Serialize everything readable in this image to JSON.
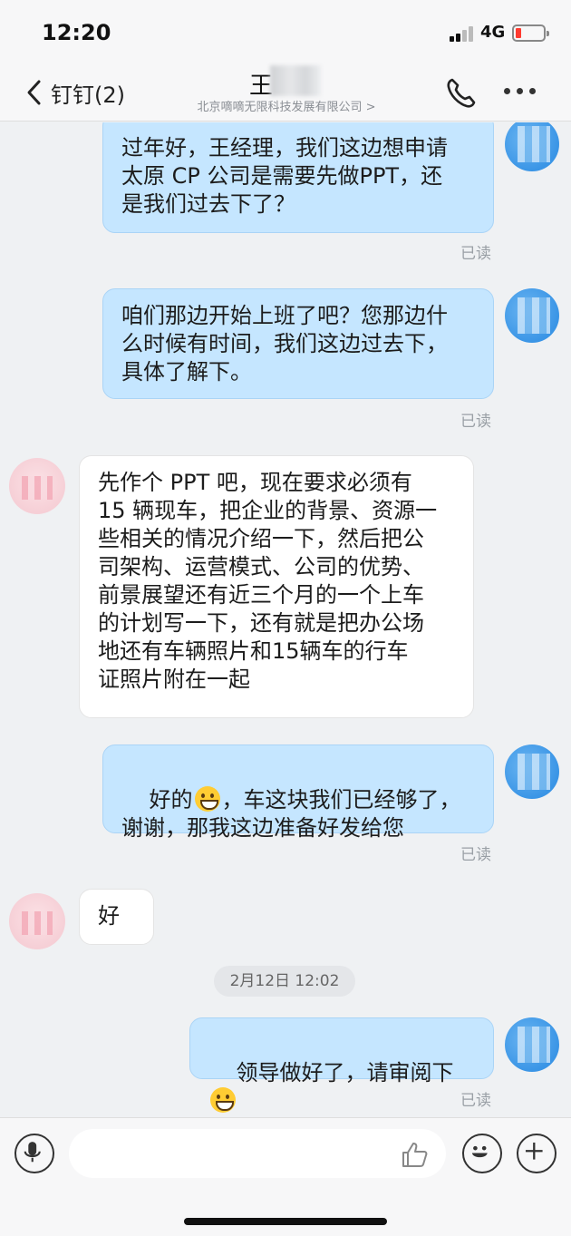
{
  "status_bar": {
    "time": "12:20",
    "network": "4G",
    "battery_level": 0.15,
    "battery_color": "#ff3b30"
  },
  "nav": {
    "back_label": "钉钉(2)",
    "back_icon": "chevron-left-icon",
    "title_visible_char": "王",
    "subtitle": "北京嘀嘀无限科技发展有限公司 >",
    "call_icon": "phone-icon",
    "more_icon": "more-dots-icon"
  },
  "messages": [
    {
      "direction": "out",
      "text": "过年好，王经理，我们这边想申请\n太原 CP 公司是需要先做PPT，还\n是我们过去下了？",
      "read": "已读"
    },
    {
      "direction": "out",
      "text": "咱们那边开始上班了吧？您那边什\n么时候有时间，我们这边过去下，\n具体了解下。",
      "read": "已读"
    },
    {
      "direction": "in",
      "text": "先作个 PPT 吧，现在要求必须有\n15 辆现车，把企业的背景、资源一\n些相关的情况介绍一下，然后把公\n司架构、运营模式、公司的优势、\n前景展望还有近三个月的一个上车\n的计划写一下，还有就是把办公场\n地还有车辆照片和15辆车的行车\n证照片附在一起"
    },
    {
      "direction": "out",
      "text_before_emoji": "好的",
      "text_after_emoji": "，车这块我们已经够了，\n谢谢，那我这边准备好发给您",
      "emoji": "grinning-emoji",
      "read": "已读"
    },
    {
      "direction": "in",
      "text": "好"
    },
    {
      "direction": "out",
      "text_before_emoji": "领导做好了，请审阅下",
      "text_after_emoji": "",
      "emoji": "grinning-sweat-emoji",
      "read": "已读"
    }
  ],
  "time_divider": "2月12日 12:02",
  "input_bar": {
    "voice_icon": "microphone-icon",
    "input_value": "",
    "like_icon": "thumbs-up-icon",
    "emoji_icon": "smiley-icon",
    "add_icon": "plus-icon"
  },
  "colors": {
    "outgoing_bubble": "#c5e6ff",
    "incoming_bubble": "#ffffff",
    "background": "#eff1f3"
  }
}
